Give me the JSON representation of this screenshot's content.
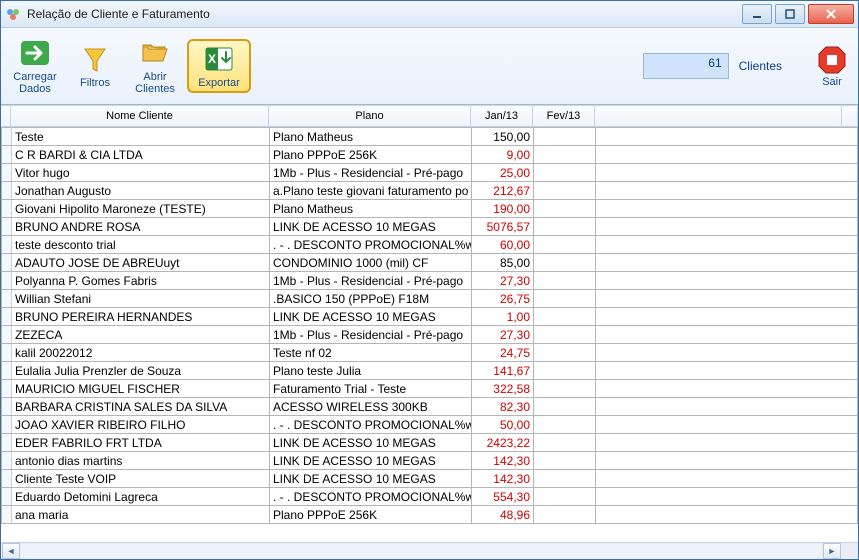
{
  "window": {
    "title": "Relação de Cliente e Faturamento"
  },
  "toolbar": {
    "carregar_label": "Carregar\nDados",
    "filtros_label": "Filtros",
    "abrir_label": "Abrir\nClientes",
    "exportar_label": "Exportar",
    "sair_label": "Sair",
    "client_count": "61",
    "client_count_label": "Clientes"
  },
  "columns": {
    "c1": "Nome Cliente",
    "c2": "Plano",
    "c3": "Jan/13",
    "c4": "Fev/13"
  },
  "rows": [
    {
      "cliente": "Teste",
      "plano": "Plano Matheus",
      "v": "150,00",
      "red": false
    },
    {
      "cliente": "C R BARDI & CIA LTDA",
      "plano": "Plano PPPoE 256K",
      "v": "9,00",
      "red": true
    },
    {
      "cliente": "Vitor hugo",
      "plano": "1Mb - Plus - Residencial - Pré-pago",
      "v": "25,00",
      "red": true
    },
    {
      "cliente": "Jonathan Augusto",
      "plano": "a.Plano teste giovani faturamento po",
      "v": "212,67",
      "red": true
    },
    {
      "cliente": "Giovani Hipolito Maroneze (TESTE)",
      "plano": "Plano Matheus",
      "v": "190,00",
      "red": true
    },
    {
      "cliente": "BRUNO ANDRE ROSA",
      "plano": "LINK DE ACESSO 10 MEGAS",
      "v": "5076,57",
      "red": true
    },
    {
      "cliente": "teste desconto trial",
      "plano": ". - . DESCONTO PROMOCIONAL%w",
      "v": "60,00",
      "red": true
    },
    {
      "cliente": "ADAUTO JOSE DE ABREUuyt",
      "plano": "CONDOMINIO 1000 (mil) CF",
      "v": "85,00",
      "red": false
    },
    {
      "cliente": "Polyanna P. Gomes Fabris",
      "plano": "1Mb - Plus - Residencial - Pré-pago",
      "v": "27,30",
      "red": true
    },
    {
      "cliente": "Willian Stefani",
      "plano": ".BASICO 150 (PPPoE) F18M",
      "v": "26,75",
      "red": true
    },
    {
      "cliente": "BRUNO PEREIRA HERNANDES",
      "plano": "LINK DE ACESSO 10 MEGAS",
      "v": "1,00",
      "red": true
    },
    {
      "cliente": "ZEZECA",
      "plano": "1Mb - Plus - Residencial - Pré-pago",
      "v": "27,30",
      "red": true
    },
    {
      "cliente": "kalil 20022012",
      "plano": "Teste nf 02",
      "v": "24,75",
      "red": true
    },
    {
      "cliente": "Eulalia Julia Prenzler de Souza",
      "plano": "Plano teste Julia",
      "v": "141,67",
      "red": true
    },
    {
      "cliente": "MAURICIO MIGUEL FISCHER",
      "plano": "Faturamento Trial - Teste",
      "v": "322,58",
      "red": true
    },
    {
      "cliente": "BARBARA CRISTINA SALES DA SILVA",
      "plano": "ACESSO WIRELESS 300KB",
      "v": "82,30",
      "red": true
    },
    {
      "cliente": "JOAO XAVIER RIBEIRO FILHO",
      "plano": ". - . DESCONTO PROMOCIONAL%w",
      "v": "50,00",
      "red": true
    },
    {
      "cliente": "EDER FABRILO  FRT LTDA",
      "plano": "LINK DE ACESSO 10 MEGAS",
      "v": "2423,22",
      "red": true
    },
    {
      "cliente": "antonio dias martins",
      "plano": "LINK DE ACESSO 10 MEGAS",
      "v": "142,30",
      "red": true
    },
    {
      "cliente": "Cliente Teste VOIP",
      "plano": "LINK DE ACESSO 10 MEGAS",
      "v": "142,30",
      "red": true
    },
    {
      "cliente": "Eduardo Detomini Lagreca",
      "plano": ". - . DESCONTO PROMOCIONAL%w",
      "v": "554,30",
      "red": true
    },
    {
      "cliente": "ana maria",
      "plano": "Plano PPPoE 256K",
      "v": "48,96",
      "red": true
    }
  ]
}
